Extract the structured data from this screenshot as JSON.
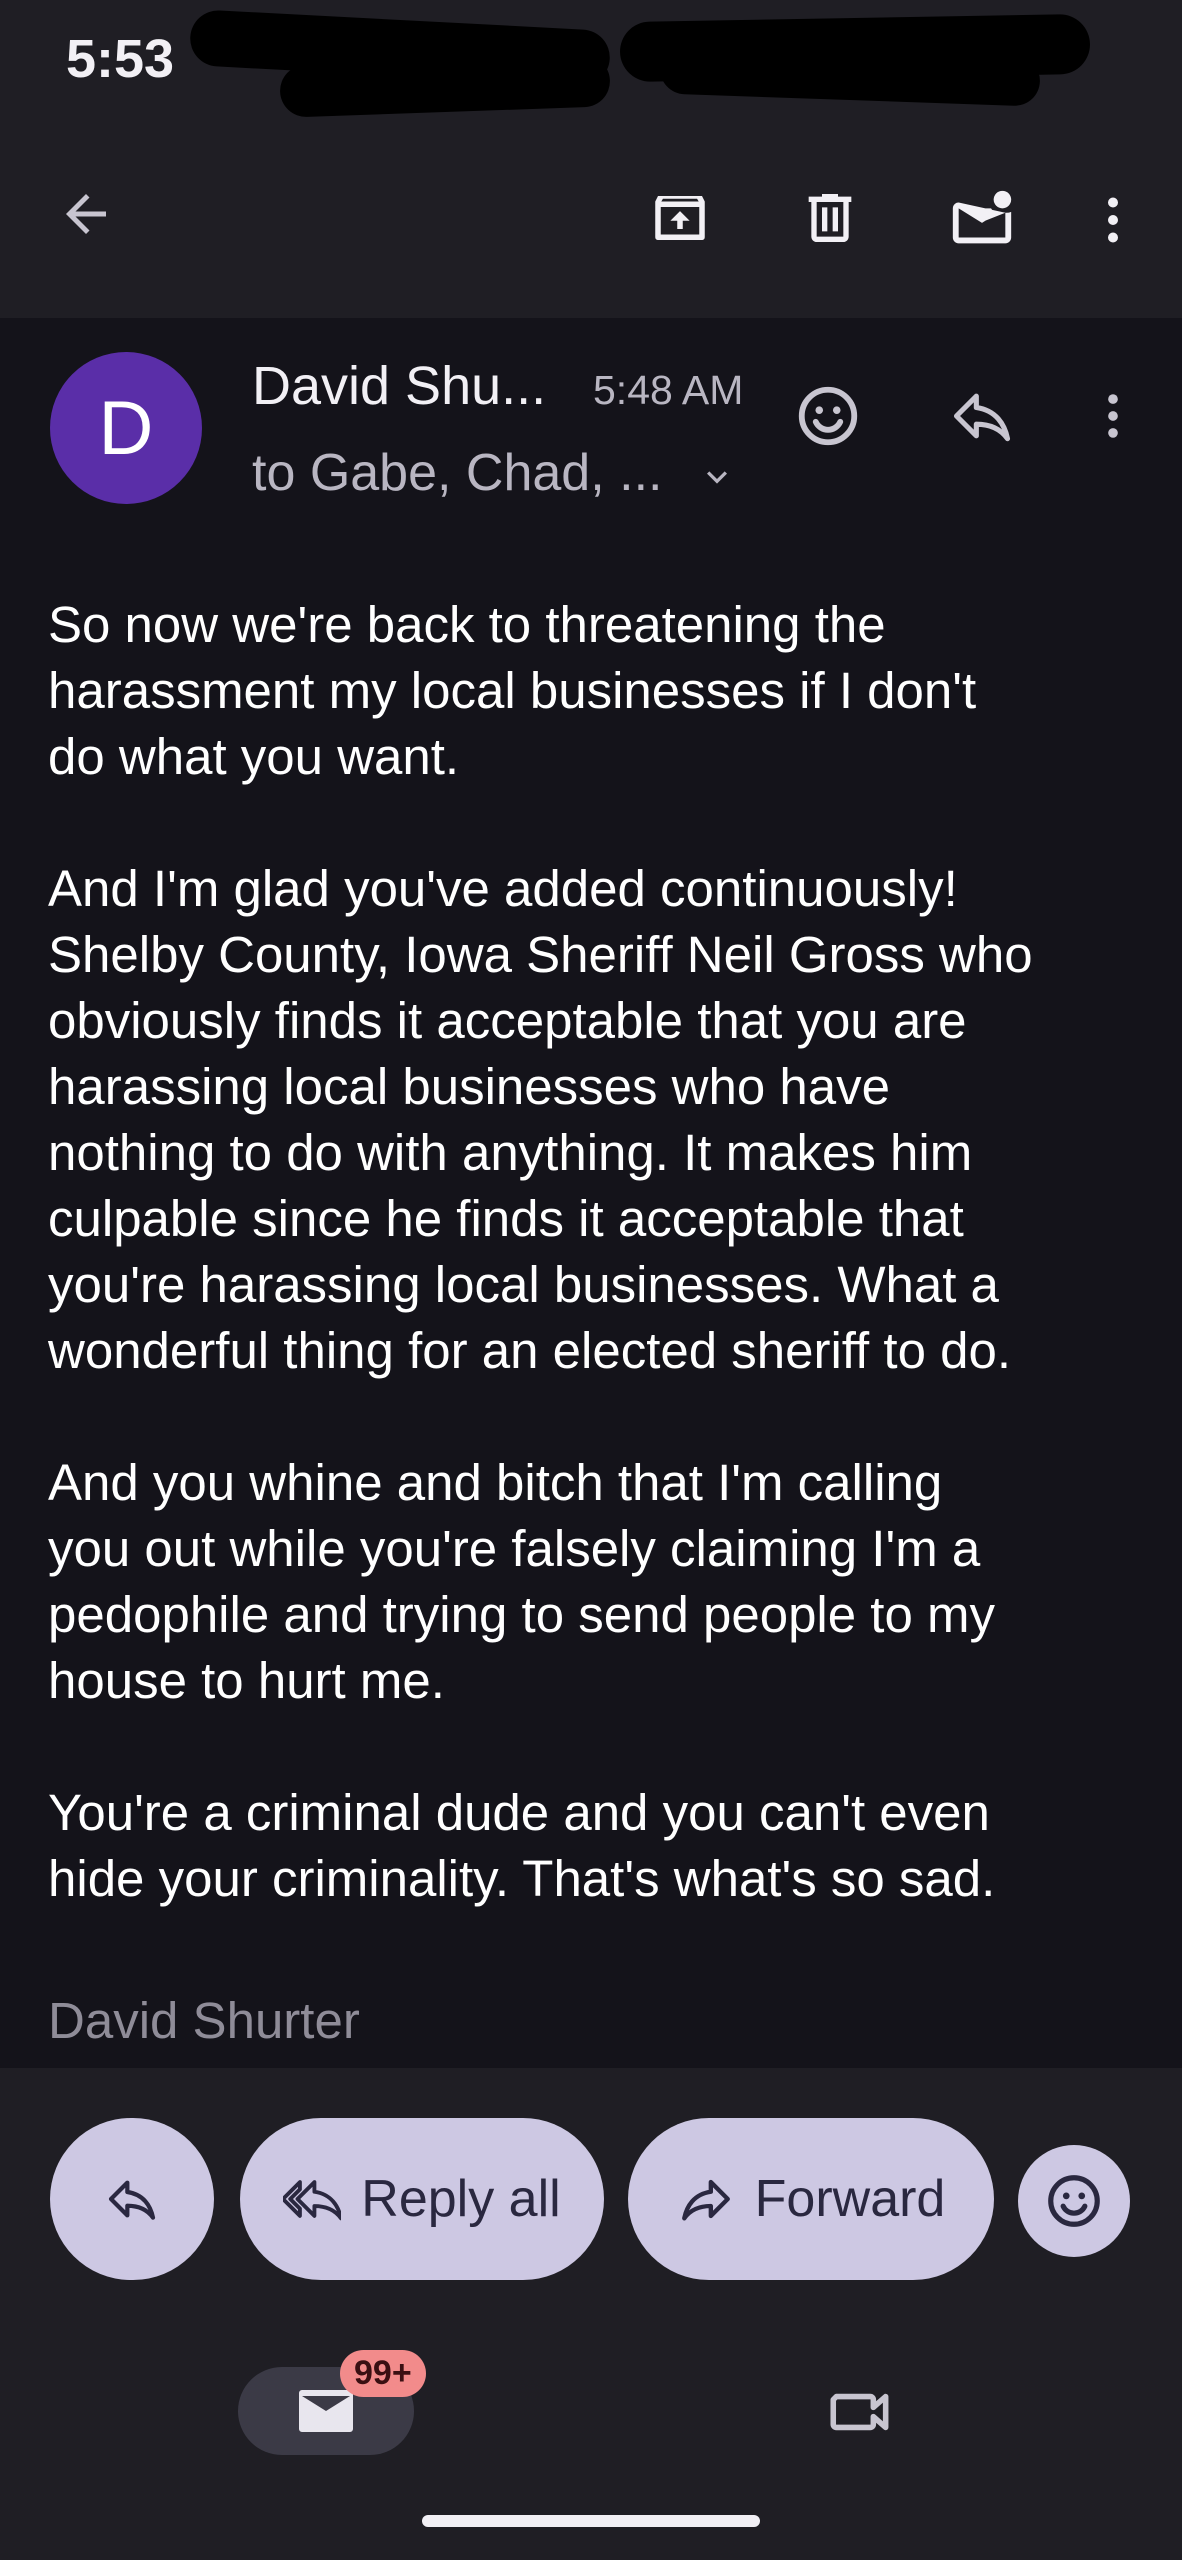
{
  "status_bar": {
    "time": "5:53"
  },
  "toolbar": {
    "back_icon": "arrow-left-icon",
    "archive_icon": "archive-icon",
    "delete_icon": "trash-icon",
    "mark_unread_icon": "mail-unread-icon",
    "more_icon": "more-vert-icon"
  },
  "message": {
    "avatar_letter": "D",
    "avatar_color": "#5a2ea8",
    "sender": "David Shu...",
    "time": "5:48 AM",
    "recipients": "to Gabe, Chad, ...",
    "body": [
      [
        "So now we're back to threatening the",
        "harassment my local businesses if I don't",
        "do what you want."
      ],
      [
        "And I'm glad you've added continuously!",
        "Shelby County, Iowa Sheriff Neil Gross who",
        "obviously finds it acceptable that you are",
        "harassing local businesses who have",
        "nothing to do with anything. It makes him",
        "culpable since he finds it acceptable that",
        "you're harassing local businesses. What a",
        "wonderful thing for an elected sheriff to do."
      ],
      [
        "And you whine and bitch that I'm calling",
        "you out while you're falsely claiming I'm a",
        "pedophile and trying to send people to my",
        "house to hurt me."
      ],
      [
        "You're a criminal dude and you can't even",
        "hide your criminality. That's what's so sad."
      ]
    ],
    "signature": "David Shurter"
  },
  "actions": {
    "reply_all": "Reply all",
    "forward": "Forward"
  },
  "bottom_nav": {
    "mail_badge": "99+",
    "mail_icon": "mail-icon",
    "meet_icon": "video-camera-icon"
  },
  "colors": {
    "background": "#14131a",
    "bar": "#1f1e24",
    "pill": "#cdc8e3",
    "badge": "#f28b8b"
  }
}
